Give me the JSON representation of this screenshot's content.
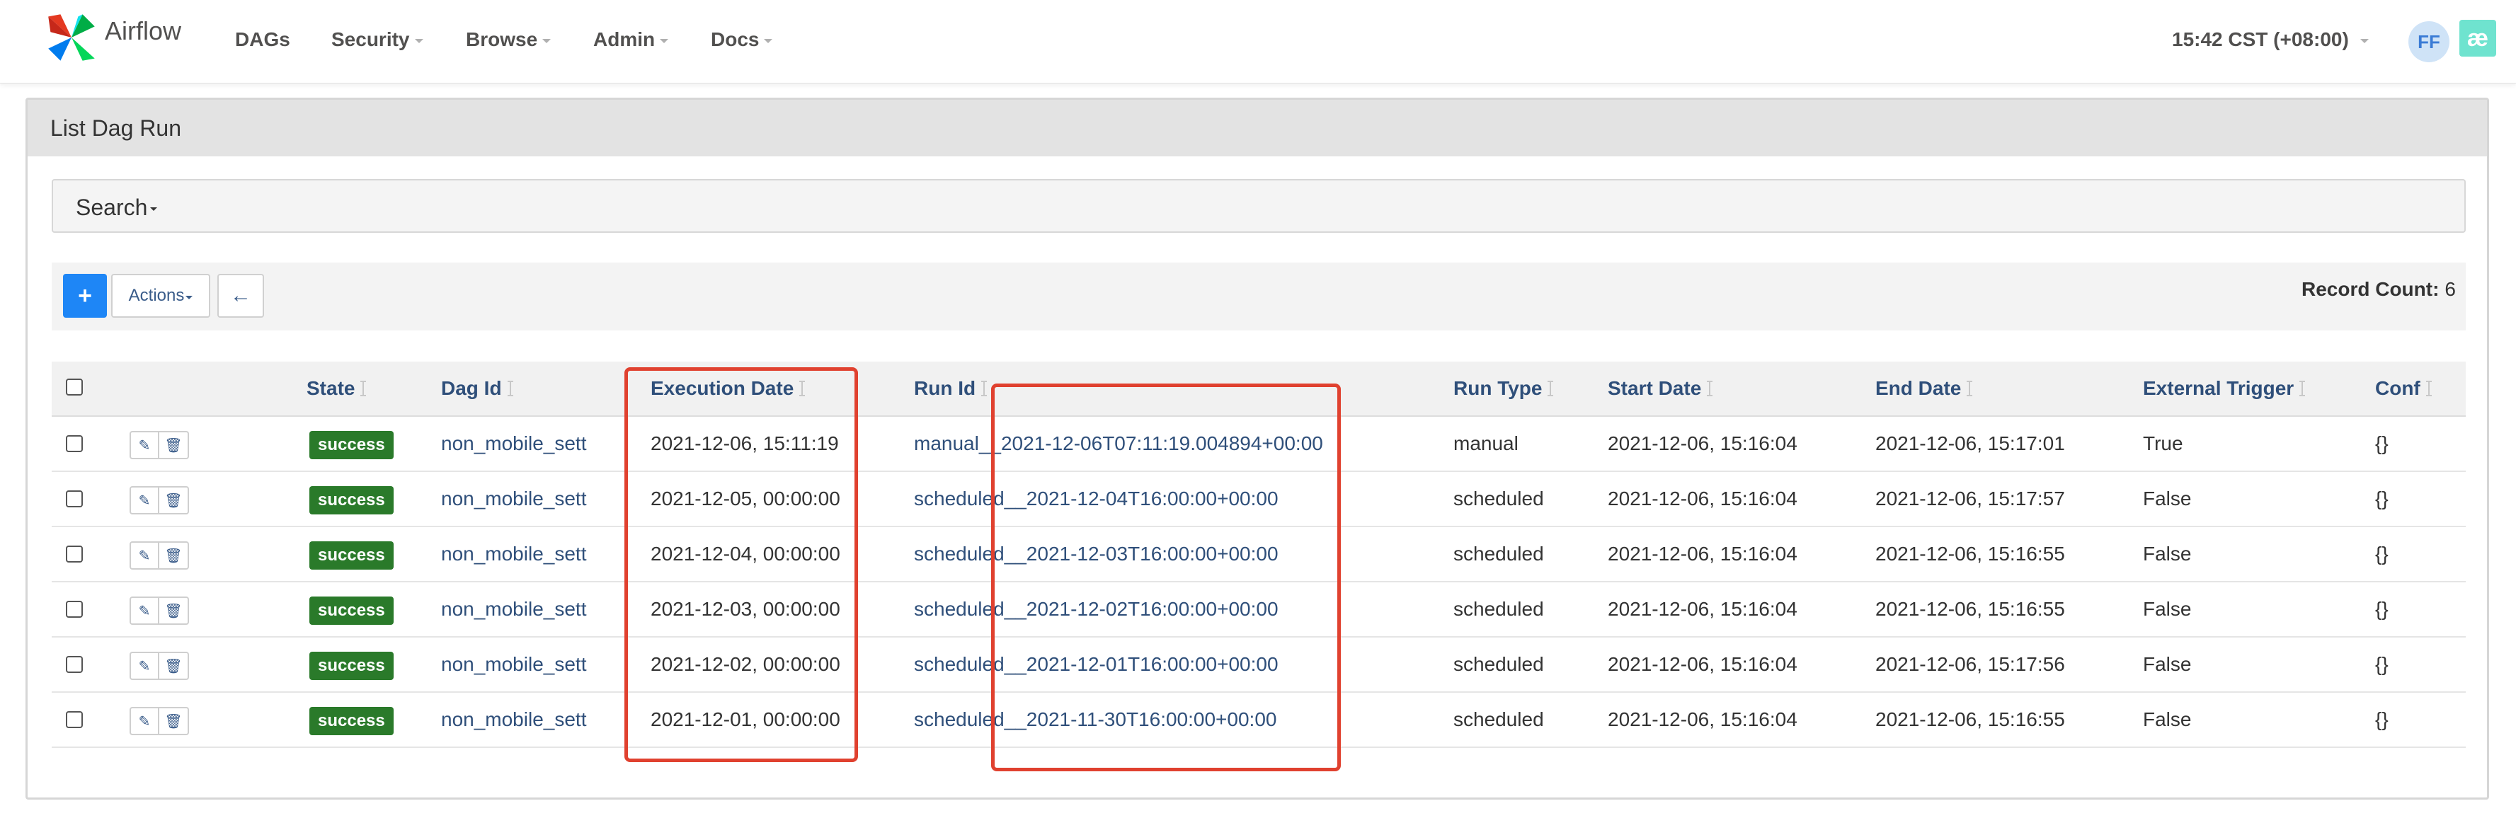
{
  "navbar": {
    "brand": "Airflow",
    "items": [
      {
        "label": "DAGs",
        "dropdown": false
      },
      {
        "label": "Security",
        "dropdown": true
      },
      {
        "label": "Browse",
        "dropdown": true
      },
      {
        "label": "Admin",
        "dropdown": true
      },
      {
        "label": "Docs",
        "dropdown": true
      }
    ],
    "clock": "15:42 CST (+08:00)",
    "user_initials": "FF",
    "extra_icon": "æ"
  },
  "page": {
    "title": "List Dag Run",
    "search_label": "Search",
    "actions_label": "Actions",
    "add_icon": "plus-icon",
    "back_icon": "arrow-left-icon",
    "record_count_label": "Record Count:",
    "record_count": "6"
  },
  "table": {
    "columns": [
      "State",
      "Dag Id",
      "Execution Date",
      "Run Id",
      "Run Type",
      "Start Date",
      "End Date",
      "External Trigger",
      "Conf"
    ],
    "rows": [
      [
        "success",
        "non_mobile_sett",
        "2021-12-06, 15:11:19",
        "manual__2021-12-06T07:11:19.004894+00:00",
        "manual",
        "2021-12-06, 15:16:04",
        "2021-12-06, 15:17:01",
        "True",
        "{}"
      ],
      [
        "success",
        "non_mobile_sett",
        "2021-12-05, 00:00:00",
        "scheduled__2021-12-04T16:00:00+00:00",
        "scheduled",
        "2021-12-06, 15:16:04",
        "2021-12-06, 15:17:57",
        "False",
        "{}"
      ],
      [
        "success",
        "non_mobile_sett",
        "2021-12-04, 00:00:00",
        "scheduled__2021-12-03T16:00:00+00:00",
        "scheduled",
        "2021-12-06, 15:16:04",
        "2021-12-06, 15:16:55",
        "False",
        "{}"
      ],
      [
        "success",
        "non_mobile_sett",
        "2021-12-03, 00:00:00",
        "scheduled__2021-12-02T16:00:00+00:00",
        "scheduled",
        "2021-12-06, 15:16:04",
        "2021-12-06, 15:16:55",
        "False",
        "{}"
      ],
      [
        "success",
        "non_mobile_sett",
        "2021-12-02, 00:00:00",
        "scheduled__2021-12-01T16:00:00+00:00",
        "scheduled",
        "2021-12-06, 15:16:04",
        "2021-12-06, 15:17:56",
        "False",
        "{}"
      ],
      [
        "success",
        "non_mobile_sett",
        "2021-12-01, 00:00:00",
        "scheduled__2021-11-30T16:00:00+00:00",
        "scheduled",
        "2021-12-06, 15:16:04",
        "2021-12-06, 15:16:55",
        "False",
        "{}"
      ]
    ],
    "row_action_icons": [
      "edit-icon",
      "trash-icon"
    ]
  },
  "colors": {
    "primary": "#1e86f6",
    "success_badge": "#2a7a2a",
    "link": "#2f4f7a",
    "highlight_annotation": "#e0412f"
  }
}
